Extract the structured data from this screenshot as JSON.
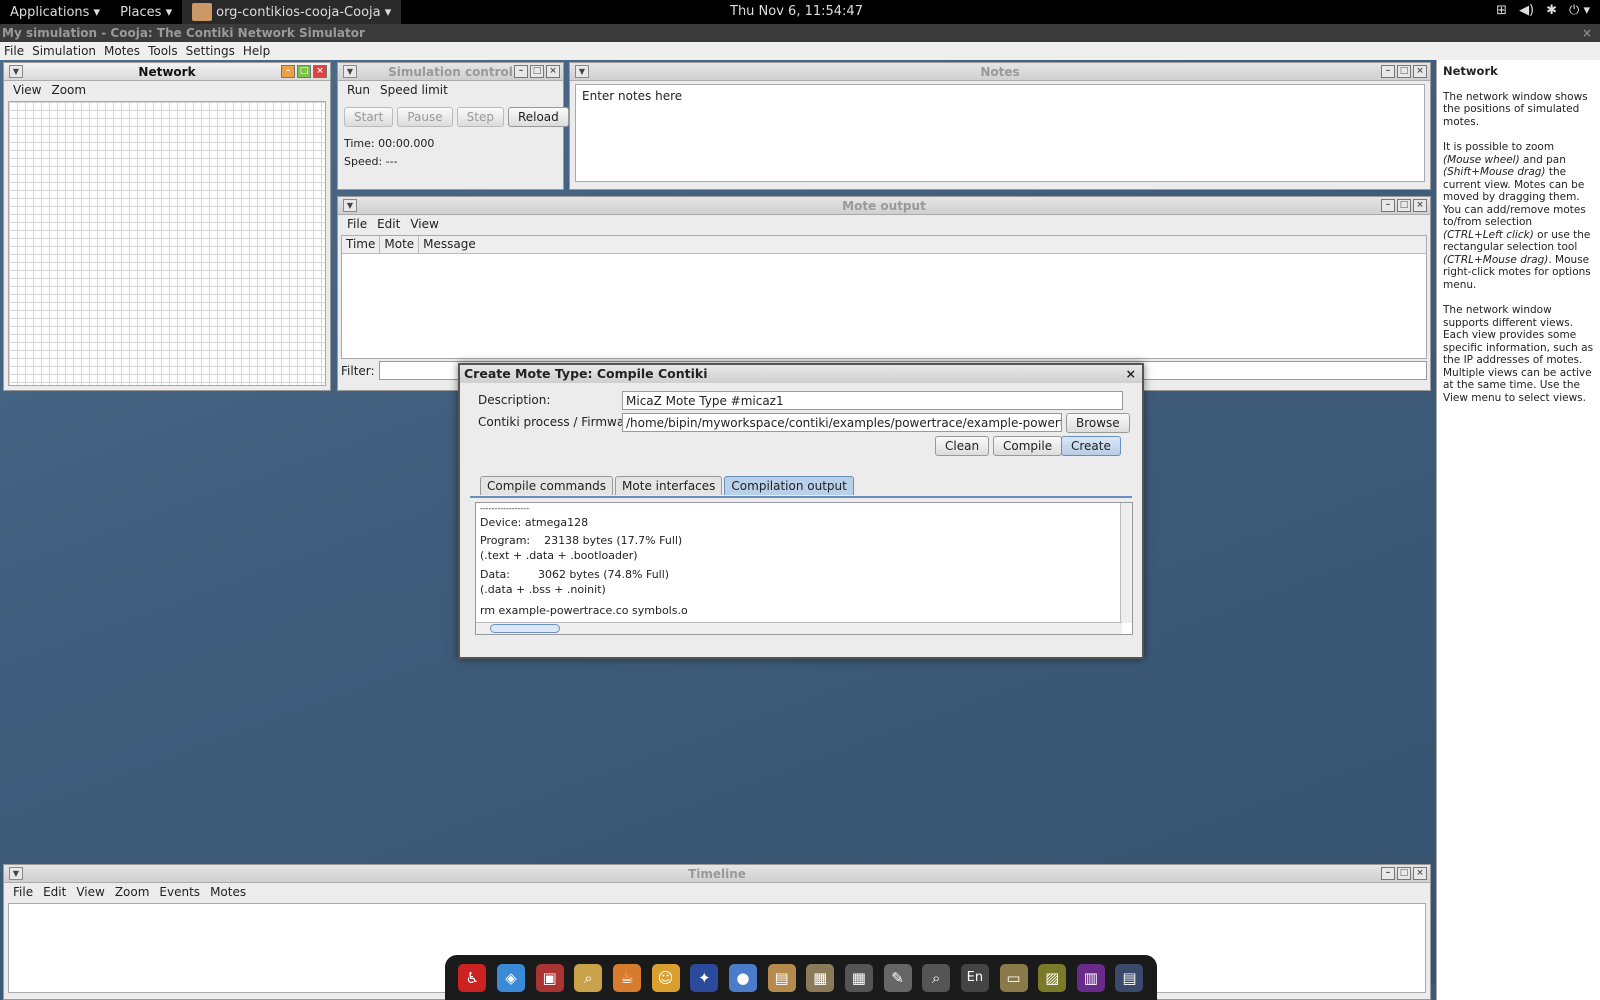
{
  "top_panel": {
    "applications": "Applications",
    "places": "Places",
    "task": "org-contikios-cooja-Cooja",
    "clock": "Thu Nov  6, 11:54:47"
  },
  "window": {
    "title": "My simulation - Cooja: The Contiki Network Simulator"
  },
  "menubar": [
    "File",
    "Simulation",
    "Motes",
    "Tools",
    "Settings",
    "Help"
  ],
  "network": {
    "title": "Network",
    "menu": [
      "View",
      "Zoom"
    ]
  },
  "simctl": {
    "title": "Simulation control",
    "menu": [
      "Run",
      "Speed limit"
    ],
    "buttons": {
      "start": "Start",
      "pause": "Pause",
      "step": "Step",
      "reload": "Reload"
    },
    "time": "Time: 00:00.000",
    "speed": "Speed: ---"
  },
  "notes": {
    "title": "Notes",
    "text": "Enter notes here"
  },
  "moteout": {
    "title": "Mote output",
    "menu": [
      "File",
      "Edit",
      "View"
    ],
    "cols": [
      "Time",
      "Mote",
      "Message"
    ],
    "filter": "Filter:"
  },
  "help": {
    "title": "Network",
    "p1": "The network window shows the positions of simulated motes.",
    "p2a": "It is possible to zoom ",
    "p2b": "(Mouse wheel)",
    "p2c": " and pan ",
    "p2d": "(Shift+Mouse drag)",
    "p2e": " the current view. Motes can be moved by dragging them. You can add/remove motes to/from selection ",
    "p2f": "(CTRL+Left click)",
    "p2g": " or use the rectangular selection tool ",
    "p2h": "(CTRL+Mouse drag)",
    "p2i": ". Mouse right-click motes for options menu.",
    "p3": "The network window supports different views. Each view provides some specific information, such as the IP addresses of motes. Multiple views can be active at the same time. Use the View menu to select views."
  },
  "timeline": {
    "title": "Timeline",
    "menu": [
      "File",
      "Edit",
      "View",
      "Zoom",
      "Events",
      "Motes"
    ]
  },
  "dialog": {
    "title": "Create Mote Type: Compile Contiki",
    "close": "×",
    "desc_label": "Description:",
    "desc_value": "MicaZ Mote Type #micaz1",
    "fw_label": "Contiki process / Firmware:",
    "fw_value": "/home/bipin/myworkspace/contiki/examples/powertrace/example-powertrace.c",
    "browse": "Browse",
    "clean": "Clean",
    "compile": "Compile",
    "create": "Create",
    "tabs": [
      "Compile commands",
      "Mote interfaces",
      "Compilation output"
    ],
    "output": [
      "-----------------",
      "Device: atmega128",
      "Program:    23138 bytes (17.7% Full)",
      "(.text + .data + .bootloader)",
      "Data:        3062 bytes (74.8% Full)",
      "(.data + .bss + .noinit)",
      "rm example-powertrace.co symbols.o"
    ]
  },
  "dock": {
    "en": "En"
  },
  "colors": {
    "panel": "#000000",
    "desktop": "#3f5d7c",
    "selected_tab": "#b9d0ea"
  }
}
